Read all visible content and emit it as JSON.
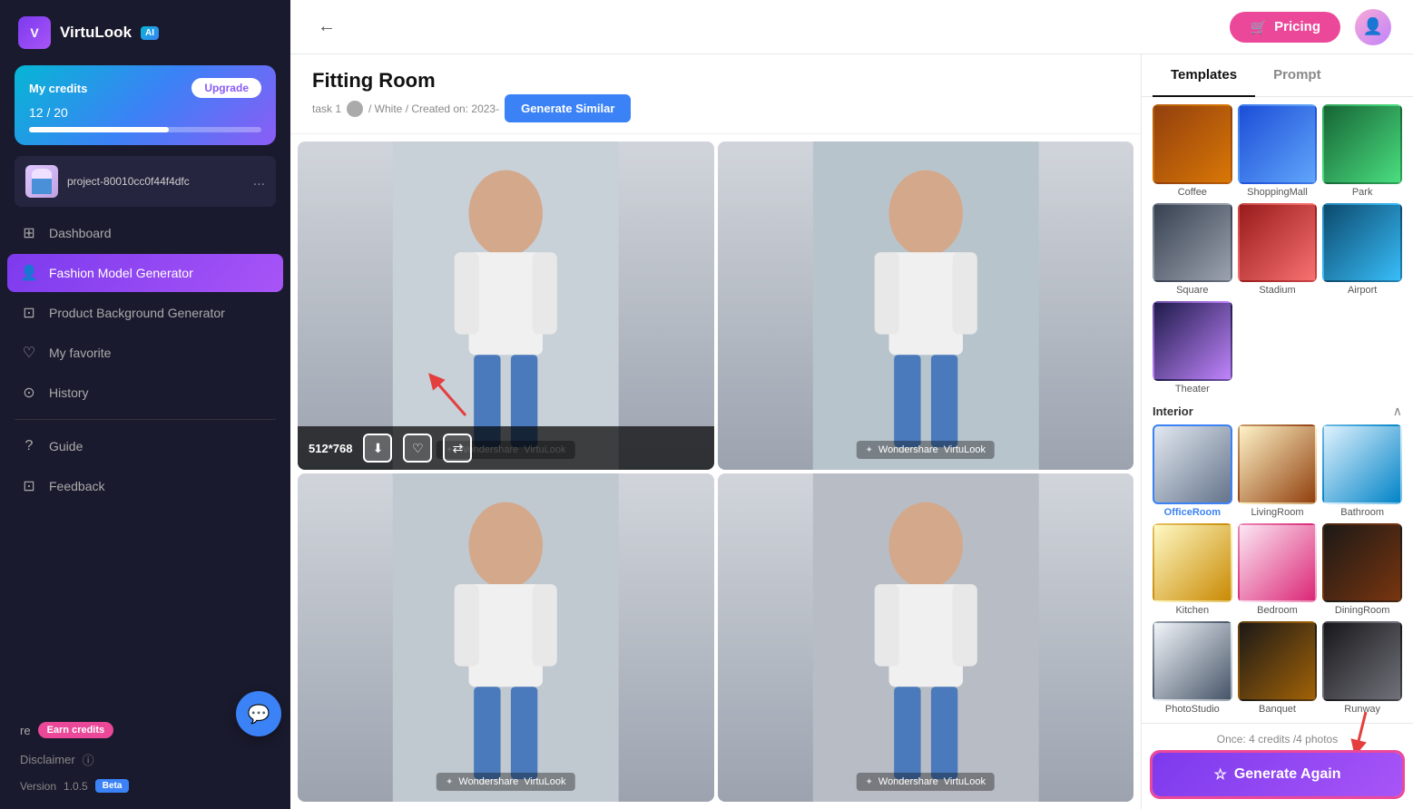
{
  "app": {
    "name": "VirtuLook",
    "ai_badge": "AI",
    "version": "1.0.5",
    "beta_label": "Beta"
  },
  "topbar": {
    "pricing_label": "Pricing",
    "pricing_icon": "🛒"
  },
  "credits": {
    "label": "My credits",
    "current": 12,
    "total": 20,
    "display": "12 / 20",
    "upgrade_label": "Upgrade",
    "bar_percent": 60
  },
  "project": {
    "name": "project-80010cc0f44f4dfc",
    "dots": "..."
  },
  "nav": {
    "items": [
      {
        "id": "dashboard",
        "label": "Dashboard",
        "icon": "⊞",
        "active": false
      },
      {
        "id": "fashion-model",
        "label": "Fashion Model Generator",
        "icon": "👤",
        "active": true
      },
      {
        "id": "product-bg",
        "label": "Product Background Generator",
        "icon": "⊡",
        "active": false
      },
      {
        "id": "favorites",
        "label": "My favorite",
        "icon": "♡",
        "active": false
      },
      {
        "id": "history",
        "label": "History",
        "icon": "⊙",
        "active": false
      }
    ],
    "bottom": [
      {
        "id": "guide",
        "label": "Guide",
        "icon": "?"
      },
      {
        "id": "feedback",
        "label": "Feedback",
        "icon": "⊡"
      }
    ]
  },
  "share": {
    "label": "re",
    "earn_label": "Earn credits"
  },
  "disclaimer": {
    "label": "Disclaimer"
  },
  "fitting": {
    "title": "Fitting Room",
    "subtitle": "task 1",
    "meta": "/ White / Created on: 2023-",
    "generate_similar_label": "Generate Similar"
  },
  "images": {
    "size_label": "512*768",
    "watermark": "VirtuLook"
  },
  "right_panel": {
    "tabs": [
      "Templates",
      "Prompt"
    ],
    "active_tab": "Templates",
    "sections": [
      {
        "id": "outdoor",
        "label": null,
        "items": [
          {
            "id": "coffee",
            "label": "Coffee",
            "class": "tmpl-coffee",
            "selected": false
          },
          {
            "id": "shoppingmall",
            "label": "ShoppingMall",
            "class": "tmpl-mall",
            "selected": false
          },
          {
            "id": "park",
            "label": "Park",
            "class": "tmpl-park",
            "selected": false
          },
          {
            "id": "square",
            "label": "Square",
            "class": "tmpl-square",
            "selected": false
          },
          {
            "id": "stadium",
            "label": "Stadium",
            "class": "tmpl-stadium",
            "selected": false
          },
          {
            "id": "airport",
            "label": "Airport",
            "class": "tmpl-airport",
            "selected": false
          }
        ]
      },
      {
        "id": "special",
        "label": null,
        "items": [
          {
            "id": "theater",
            "label": "Theater",
            "class": "tmpl-theater",
            "selected": false
          }
        ]
      },
      {
        "id": "interior",
        "label": "Interior",
        "collapsible": true,
        "items": [
          {
            "id": "officeroom",
            "label": "OfficeRoom",
            "class": "tmpl-officeroom",
            "selected": true
          },
          {
            "id": "livingroom",
            "label": "LivingRoom",
            "class": "tmpl-livingroom",
            "selected": false
          },
          {
            "id": "bathroom",
            "label": "Bathroom",
            "class": "tmpl-bathroom",
            "selected": false
          },
          {
            "id": "kitchen",
            "label": "Kitchen",
            "class": "tmpl-kitchen",
            "selected": false
          },
          {
            "id": "bedroom",
            "label": "Bedroom",
            "class": "tmpl-bedroom",
            "selected": false
          },
          {
            "id": "diningroom",
            "label": "DiningRoom",
            "class": "tmpl-diningroom",
            "selected": false
          },
          {
            "id": "photostudio",
            "label": "PhotoStudio",
            "class": "tmpl-photostudio",
            "selected": false
          },
          {
            "id": "banquet",
            "label": "Banquet",
            "class": "tmpl-banquet",
            "selected": false
          },
          {
            "id": "runway",
            "label": "Runway",
            "class": "tmpl-runway",
            "selected": false
          }
        ]
      }
    ],
    "credits_note": "Once: 4 credits /4 photos",
    "generate_again_label": "Generate Again"
  }
}
